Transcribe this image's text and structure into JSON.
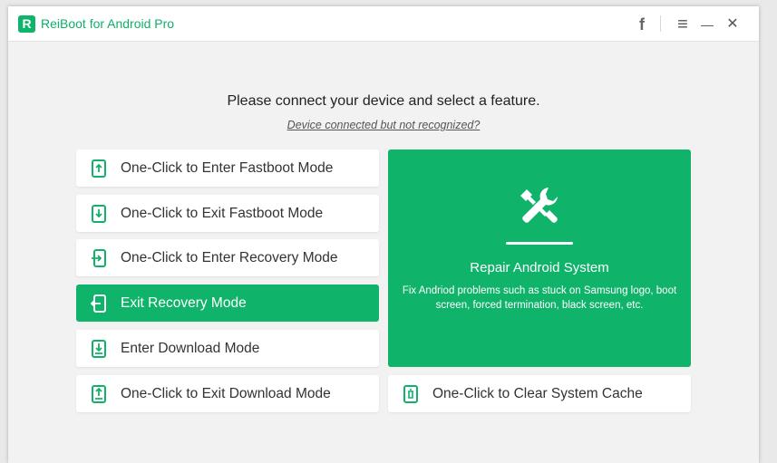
{
  "window": {
    "app_title": "ReiBoot for Android Pro",
    "logo_letter": "R"
  },
  "titlebar": {
    "facebook_glyph": "f",
    "menu_glyph": "≡",
    "minimize_glyph": "—",
    "close_glyph": "✕"
  },
  "main": {
    "heading": "Please connect your device and select a feature.",
    "subheading": "Device connected but not recognized?"
  },
  "features": [
    {
      "label": "One-Click to Enter Fastboot Mode",
      "icon": "phone-arrow-up-icon"
    },
    {
      "label": "One-Click to Exit Fastboot Mode",
      "icon": "phone-arrow-down-icon"
    },
    {
      "label": "One-Click to Enter Recovery Mode",
      "icon": "phone-enter-icon"
    },
    {
      "label": "Exit Recovery Mode",
      "icon": "phone-exit-icon"
    },
    {
      "label": "Enter Download Mode",
      "icon": "phone-download-icon"
    },
    {
      "label": "One-Click to Exit Download Mode",
      "icon": "phone-upload-icon"
    }
  ],
  "repair": {
    "title": "Repair Android System",
    "description": "Fix Andriod problems such as stuck on Samsung logo, boot screen, forced termination, black screen, etc."
  },
  "cache": {
    "label": "One-Click to Clear System Cache"
  },
  "colors": {
    "accent": "#0fb36a",
    "icon_green": "#13b06a"
  }
}
